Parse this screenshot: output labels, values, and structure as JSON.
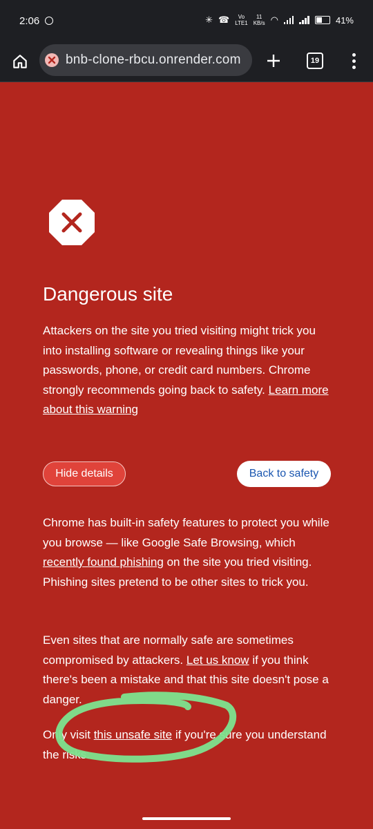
{
  "status": {
    "time": "2:06",
    "net_speed_top": "11",
    "net_speed_bottom": "KB/s",
    "volte_top": "Vo",
    "volte_bottom": "LTE1",
    "battery": "41%"
  },
  "toolbar": {
    "url": "bnb-clone-rbcu.onrender.com",
    "tab_count": "19"
  },
  "interstitial": {
    "title": "Dangerous site",
    "p1_text": "Attackers on the site you tried visiting might trick you into installing software or revealing things like your passwords, phone, or credit card numbers. Chrome strongly recommends going back to safety. ",
    "p1_link": "Learn more about this warning",
    "hide_details_label": "Hide details",
    "back_to_safety_label": "Back to safety",
    "p2_a": "Chrome has built-in safety features to protect you while you browse — like Google Safe Browsing, which ",
    "p2_link": "recently found phishing",
    "p2_b": " on the site you tried visiting. Phishing sites pretend to be other sites to trick you.",
    "p3_a": "Even sites that are normally safe are sometimes compromised by attackers. ",
    "p3_link": "Let us know",
    "p3_b": " if you think there's been a mistake and that this site doesn't pose a danger.",
    "p4_a": "Only visit ",
    "p4_link": "this unsafe site",
    "p4_b": " if you're sure you understand the risks."
  },
  "colors": {
    "danger_background": "#b3261e",
    "annotation_stroke": "#7de38f",
    "back_button_text": "#1a56b0"
  },
  "icons": [
    "home-icon",
    "danger-x-icon",
    "plus-icon",
    "tab-switcher-icon",
    "overflow-menu-icon",
    "stop-sign-icon"
  ]
}
